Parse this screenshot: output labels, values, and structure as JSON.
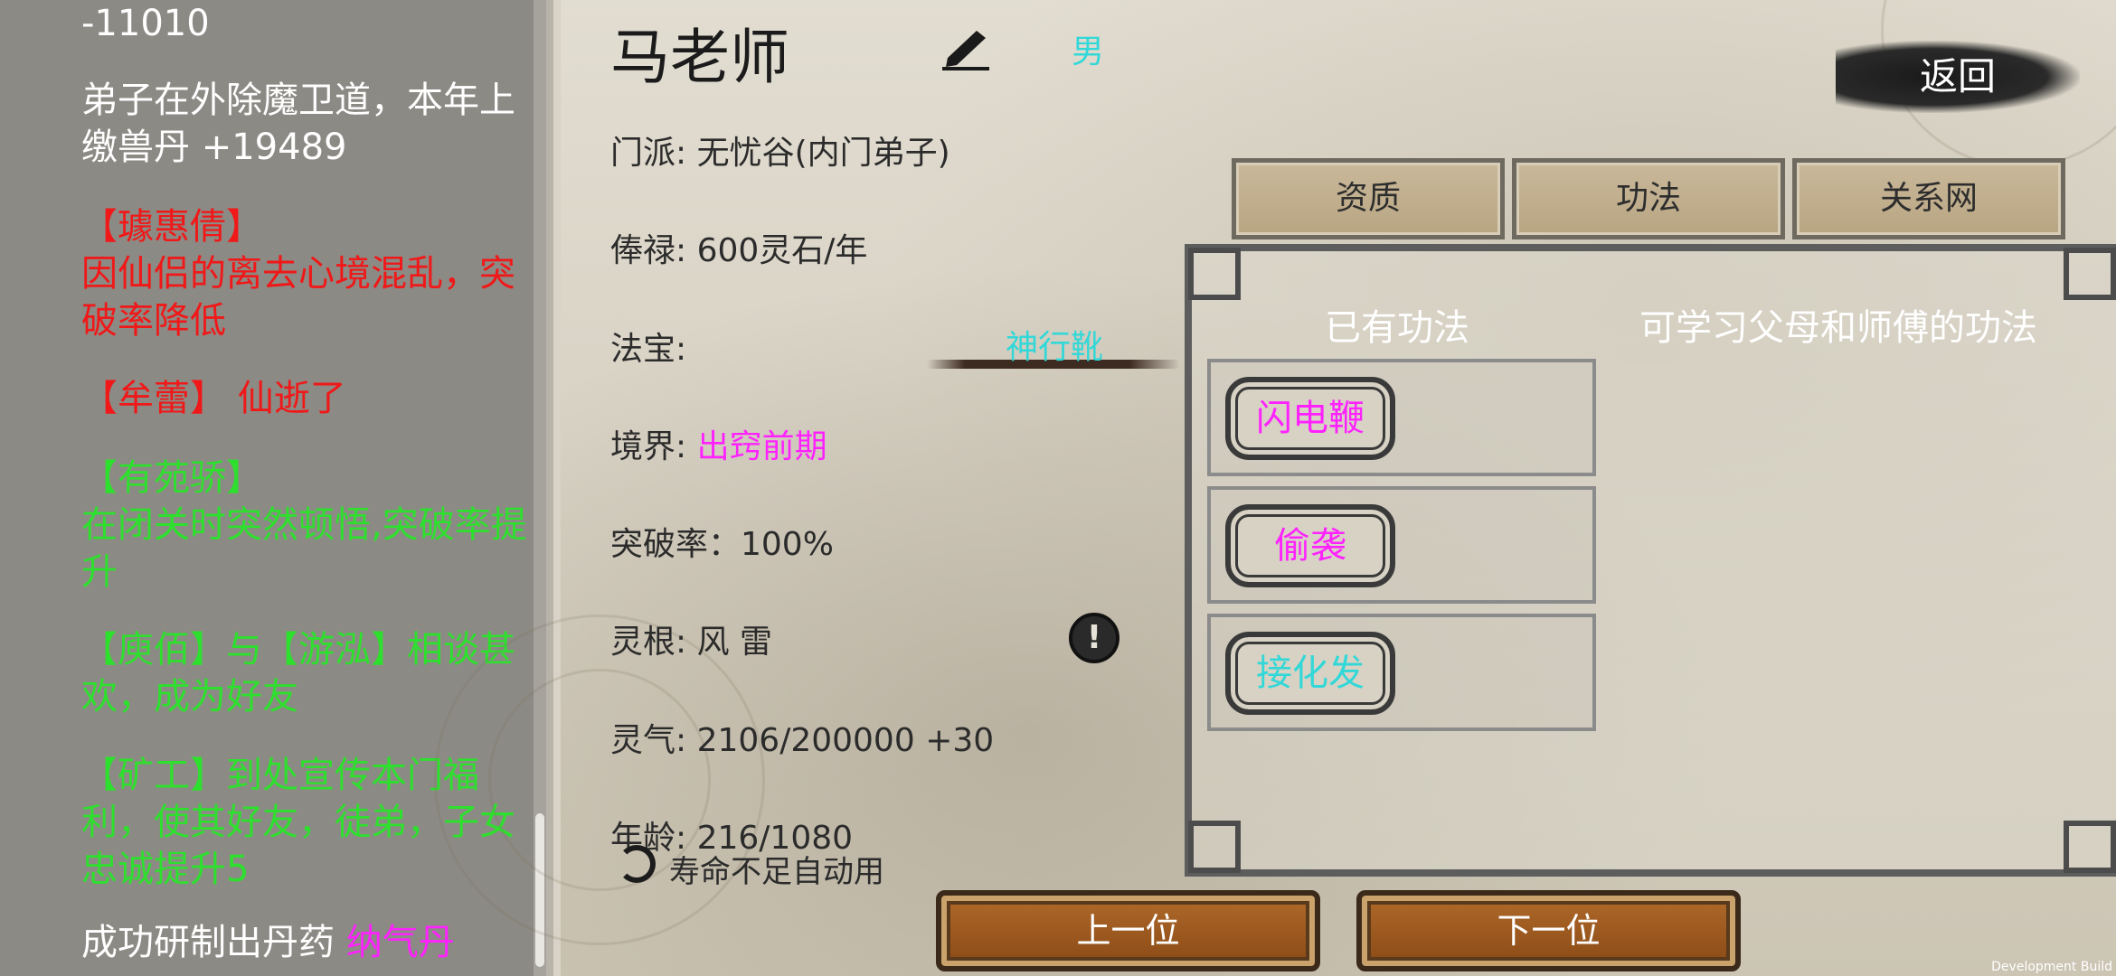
{
  "log": {
    "entries": [
      {
        "text": "-11010",
        "color": "white"
      },
      {
        "text": "弟子在外除魔卫道，本年上缴兽丹 +19489",
        "color": "white"
      },
      {
        "text": "【璩惠倩】",
        "color": "red"
      },
      {
        "text": "因仙侣的离去心境混乱，突破率降低",
        "color": "red"
      },
      {
        "text": "【牟蕾】 仙逝了",
        "color": "red"
      },
      {
        "text": "【有苑骄】",
        "color": "green"
      },
      {
        "text": "在闭关时突然顿悟,突破率提升",
        "color": "green"
      },
      {
        "text": "【庾佰】与【游泓】相谈甚欢，成为好友",
        "color": "green"
      },
      {
        "text": "【矿工】到处宣传本门福利，使其好友，徒弟，子女忠诚提升5",
        "color": "green"
      },
      {
        "text_prefix": "成功研制出丹药 ",
        "text_highlight": "纳气丹"
      }
    ]
  },
  "character": {
    "name": "马老师",
    "gender": "男",
    "sect_label": "门派: 无忧谷(内门弟子)",
    "salary_label": "俸禄: 600灵石/年",
    "treasure_label": "法宝:",
    "treasure_value": "神行靴",
    "realm_label": "境界: ",
    "realm_value": "出窍前期",
    "breakthrough_label": "突破率：100%",
    "root_label": "灵根: 风 雷",
    "qi_label": "灵气: 2106/200000 +30",
    "age_label": "年龄: 216/1080",
    "auto_use_label": "寿命不足自动用"
  },
  "back_button": "返回",
  "tabs": [
    "资质",
    "功法",
    "关系网"
  ],
  "skills_panel": {
    "owned_title": "已有功法",
    "learnable_title": "可学习父母和师傅的功法",
    "owned": [
      {
        "name": "闪电鞭",
        "color": "magenta"
      },
      {
        "name": "偷袭",
        "color": "magenta"
      },
      {
        "name": "接化发",
        "color": "cyan"
      }
    ]
  },
  "nav": {
    "prev": "上一位",
    "next": "下一位"
  },
  "dev_build": "Development Build",
  "colors": {
    "red": "#f01818",
    "green": "#2ee02e",
    "magenta": "#ff22ff",
    "cyan": "#32d8d8"
  }
}
